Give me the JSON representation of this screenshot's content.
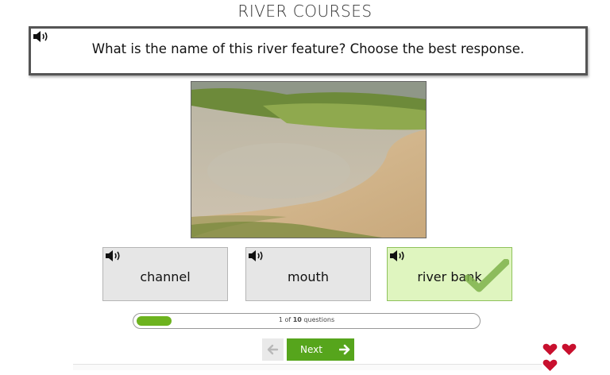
{
  "header": {
    "title": "RIVER COURSES"
  },
  "question": {
    "text": "What is the name of this river feature? Choose the best response.",
    "audio_icon": "speaker-icon"
  },
  "image": {
    "alt": ""
  },
  "options": [
    {
      "label": "channel",
      "state": "default",
      "audio_icon": "speaker-icon"
    },
    {
      "label": "mouth",
      "state": "default",
      "audio_icon": "speaker-icon"
    },
    {
      "label": "river bank",
      "state": "correct",
      "audio_icon": "speaker-icon",
      "mark_icon": "checkmark-icon"
    }
  ],
  "progress": {
    "current": "1",
    "of_label": "of",
    "total": "10",
    "suffix": "questions",
    "fraction": 0.1
  },
  "navigation": {
    "back_icon": "arrow-left-icon",
    "next_label": "Next",
    "next_icon": "arrow-right-icon"
  },
  "lives": {
    "count": 3,
    "icon": "heart-icon"
  },
  "colors": {
    "accent_green": "#56a51c",
    "progress_green": "#6db31f",
    "correct_bg": "#dff5bf",
    "option_bg": "#e6e6e6",
    "heart_red": "#c8102e"
  }
}
